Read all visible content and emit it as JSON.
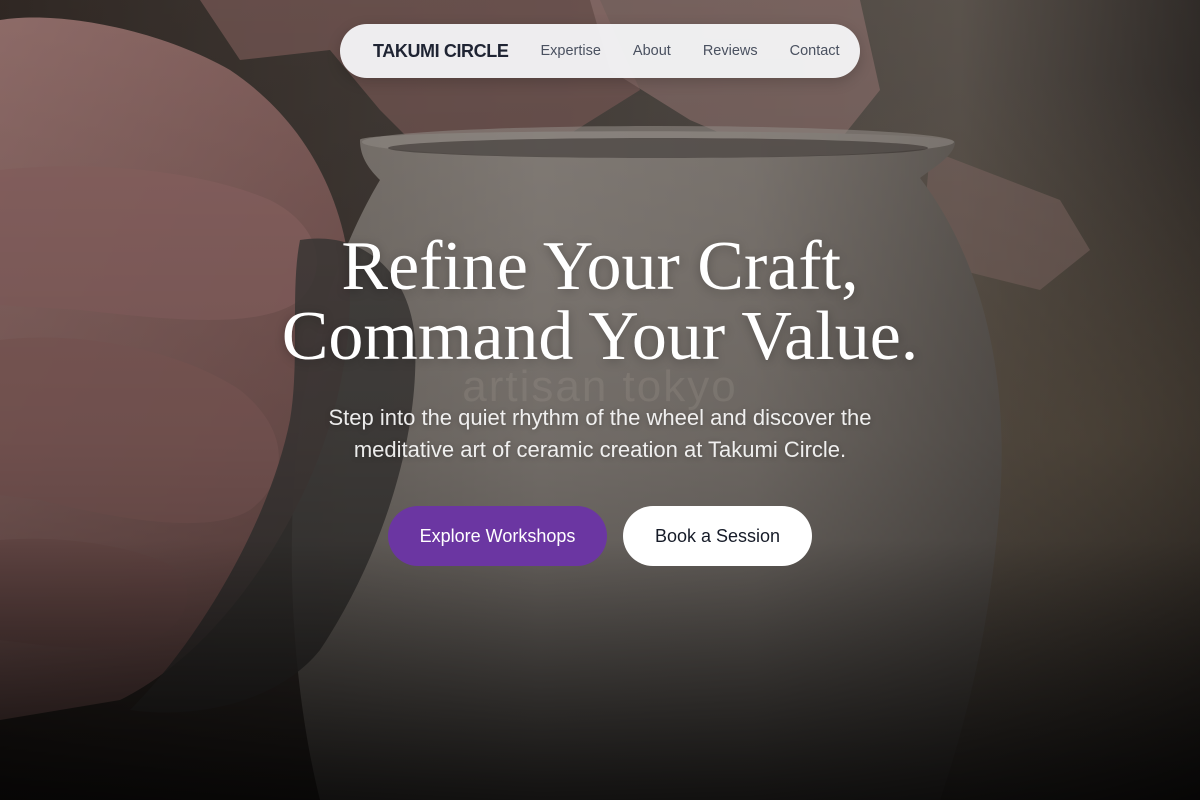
{
  "nav": {
    "brand": "TAKUMI CIRCLE",
    "links": [
      "Expertise",
      "About",
      "Reviews",
      "Contact"
    ]
  },
  "hero": {
    "headline_line1": "Refine Your Craft,",
    "headline_line2": "Command Your Value.",
    "watermark": "artisan tokyo",
    "subtitle": "Step into the quiet rhythm of the wheel and discover the meditative art of ceramic creation at Takumi Circle.",
    "primary_cta": "Explore Workshops",
    "secondary_cta": "Book a Session",
    "background_image": "pottery-wheel-hands-shaping-clay-vase"
  },
  "colors": {
    "primary_button": "#6b36a2",
    "nav_background": "#f4f4f6",
    "brand_text": "#1f2433",
    "nav_link_text": "#4a5160",
    "headline_text": "#ffffff"
  }
}
